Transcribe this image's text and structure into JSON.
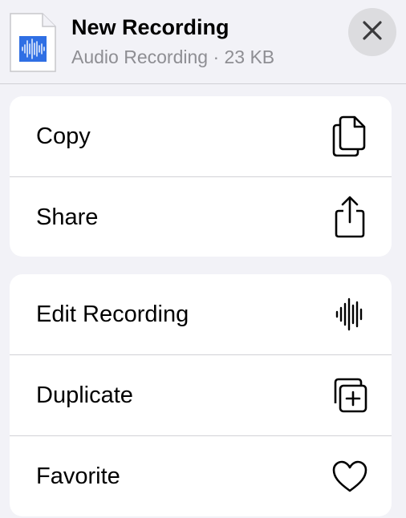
{
  "header": {
    "title": "New Recording",
    "subtitle": "Audio Recording · 23 KB",
    "file_icon": "audio-file-icon",
    "close_icon": "close-icon"
  },
  "groups": [
    {
      "items": [
        {
          "label": "Copy",
          "icon": "copy-icon"
        },
        {
          "label": "Share",
          "icon": "share-icon"
        }
      ]
    },
    {
      "items": [
        {
          "label": "Edit Recording",
          "icon": "waveform-icon"
        },
        {
          "label": "Duplicate",
          "icon": "duplicate-icon"
        },
        {
          "label": "Favorite",
          "icon": "heart-icon"
        }
      ]
    }
  ],
  "colors": {
    "background": "#f2f2f7",
    "card": "#ffffff",
    "secondary_text": "#8e8e93",
    "separator": "#d1d1d6",
    "close_button_bg": "#dcdcdf",
    "waveform_blue": "#2f6fe4"
  }
}
